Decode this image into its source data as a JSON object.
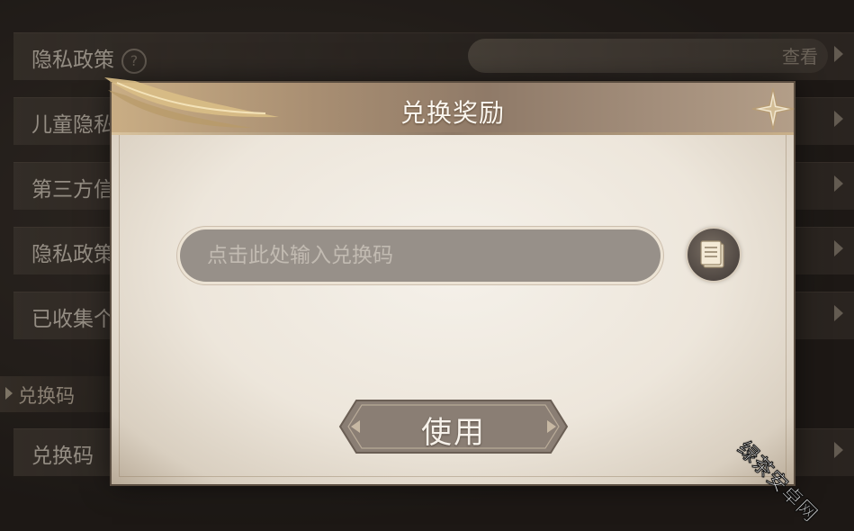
{
  "background": {
    "rows": [
      {
        "label": "隐私政策",
        "has_help": true,
        "value": "查看"
      },
      {
        "label": "儿童隐私",
        "has_help": false,
        "value": ""
      },
      {
        "label": "第三方信",
        "has_help": false,
        "value": ""
      },
      {
        "label": "隐私政策",
        "has_help": false,
        "value": ""
      },
      {
        "label": "已收集个",
        "has_help": false,
        "value": ""
      },
      {
        "label": "兑换码",
        "has_help": false,
        "value": ""
      }
    ],
    "section_header": "兑换码",
    "help_glyph": "?"
  },
  "modal": {
    "title": "兑换奖励",
    "input_placeholder": "点击此处输入兑换码",
    "input_value": "",
    "use_button": "使用",
    "paste_icon": "paste-icon",
    "close_icon": "close-icon"
  },
  "watermark": "绿茶安卓网",
  "colors": {
    "header_gold": "#c9ad84",
    "input_fill": "#979089",
    "panel_paper": "#f5f1ea"
  }
}
